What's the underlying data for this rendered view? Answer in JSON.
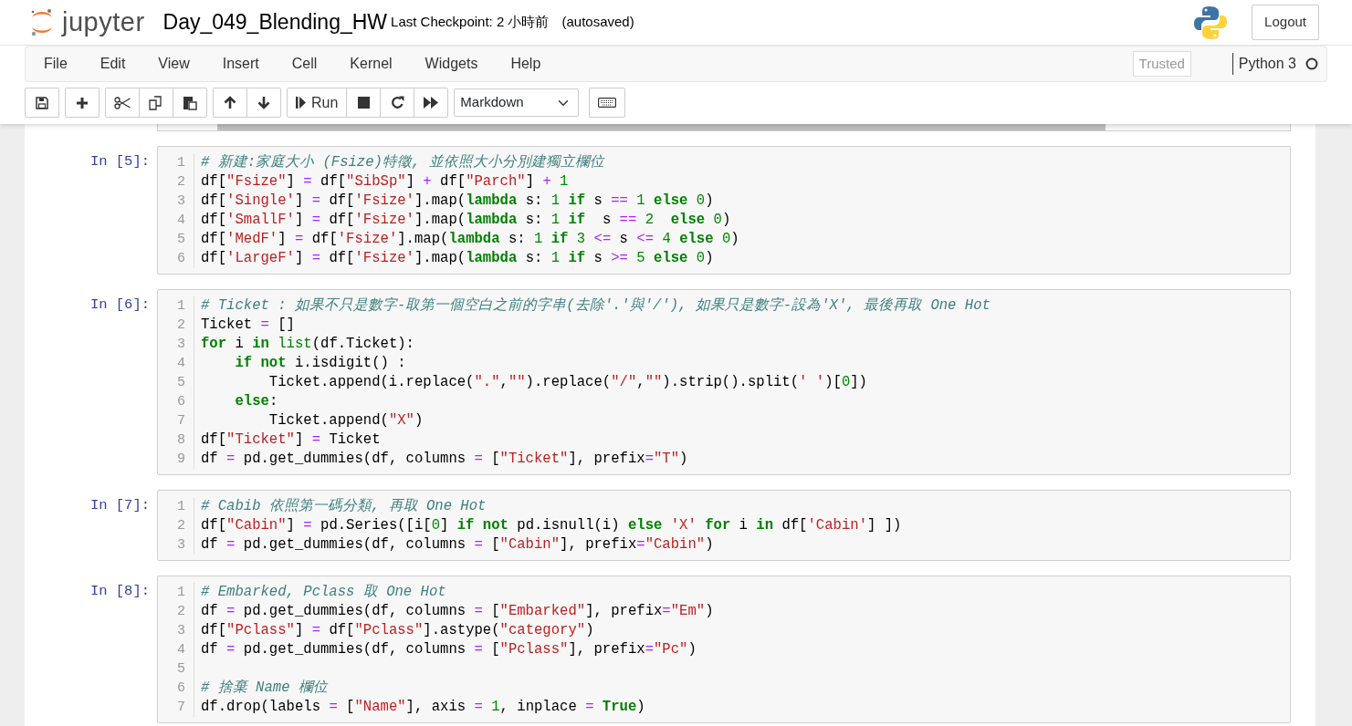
{
  "header": {
    "logo_text": "jupyter",
    "notebook_title": "Day_049_Blending_HW",
    "checkpoint": "Last Checkpoint: 2 小時前",
    "autosave": "(autosaved)",
    "logout": "Logout"
  },
  "menu": [
    "File",
    "Edit",
    "View",
    "Insert",
    "Cell",
    "Kernel",
    "Widgets",
    "Help"
  ],
  "trusted": "Trusted",
  "kernel": {
    "name": "Python 3",
    "busy": false
  },
  "toolbar": {
    "run_label": "Run",
    "cell_type": "Markdown"
  },
  "cells": [
    {
      "prompt": "In [5]:",
      "lines": [
        {
          "number": "1",
          "tokens": [
            {
              "kind": "comment",
              "text": "# 新建:家庭大小 (Fsize)特徵, 並依照大小分別建獨立欄位"
            }
          ]
        },
        {
          "number": "2",
          "tokens": [
            {
              "kind": "plain",
              "text": "df["
            },
            {
              "kind": "string",
              "text": "\"Fsize\""
            },
            {
              "kind": "plain",
              "text": "] "
            },
            {
              "kind": "operator",
              "text": "="
            },
            {
              "kind": "plain",
              "text": " df["
            },
            {
              "kind": "string",
              "text": "\"SibSp\""
            },
            {
              "kind": "plain",
              "text": "] "
            },
            {
              "kind": "operator",
              "text": "+"
            },
            {
              "kind": "plain",
              "text": " df["
            },
            {
              "kind": "string",
              "text": "\"Parch\""
            },
            {
              "kind": "plain",
              "text": "] "
            },
            {
              "kind": "operator",
              "text": "+ "
            },
            {
              "kind": "number",
              "text": "1"
            }
          ]
        },
        {
          "number": "3",
          "tokens": [
            {
              "kind": "plain",
              "text": "df["
            },
            {
              "kind": "string",
              "text": "'Single'"
            },
            {
              "kind": "plain",
              "text": "] "
            },
            {
              "kind": "operator",
              "text": "="
            },
            {
              "kind": "plain",
              "text": " df["
            },
            {
              "kind": "string",
              "text": "'Fsize'"
            },
            {
              "kind": "plain",
              "text": "].map("
            },
            {
              "kind": "keyword",
              "text": "lambda"
            },
            {
              "kind": "plain",
              "text": " s: "
            },
            {
              "kind": "number",
              "text": "1 "
            },
            {
              "kind": "keyword",
              "text": "if"
            },
            {
              "kind": "plain",
              "text": " s "
            },
            {
              "kind": "operator",
              "text": "== "
            },
            {
              "kind": "number",
              "text": "1 "
            },
            {
              "kind": "keyword",
              "text": "else "
            },
            {
              "kind": "number",
              "text": "0"
            },
            {
              "kind": "plain",
              "text": ")"
            }
          ]
        },
        {
          "number": "4",
          "tokens": [
            {
              "kind": "plain",
              "text": "df["
            },
            {
              "kind": "string",
              "text": "'SmallF'"
            },
            {
              "kind": "plain",
              "text": "] "
            },
            {
              "kind": "operator",
              "text": "="
            },
            {
              "kind": "plain",
              "text": " df["
            },
            {
              "kind": "string",
              "text": "'Fsize'"
            },
            {
              "kind": "plain",
              "text": "].map("
            },
            {
              "kind": "keyword",
              "text": "lambda"
            },
            {
              "kind": "plain",
              "text": " s: "
            },
            {
              "kind": "number",
              "text": "1 "
            },
            {
              "kind": "keyword",
              "text": "if"
            },
            {
              "kind": "plain",
              "text": "  s "
            },
            {
              "kind": "operator",
              "text": "== "
            },
            {
              "kind": "number",
              "text": "2  "
            },
            {
              "kind": "keyword",
              "text": "else "
            },
            {
              "kind": "number",
              "text": "0"
            },
            {
              "kind": "plain",
              "text": ")"
            }
          ]
        },
        {
          "number": "5",
          "tokens": [
            {
              "kind": "plain",
              "text": "df["
            },
            {
              "kind": "string",
              "text": "'MedF'"
            },
            {
              "kind": "plain",
              "text": "] "
            },
            {
              "kind": "operator",
              "text": "="
            },
            {
              "kind": "plain",
              "text": " df["
            },
            {
              "kind": "string",
              "text": "'Fsize'"
            },
            {
              "kind": "plain",
              "text": "].map("
            },
            {
              "kind": "keyword",
              "text": "lambda"
            },
            {
              "kind": "plain",
              "text": " s: "
            },
            {
              "kind": "number",
              "text": "1 "
            },
            {
              "kind": "keyword",
              "text": "if "
            },
            {
              "kind": "number",
              "text": "3 "
            },
            {
              "kind": "operator",
              "text": "<="
            },
            {
              "kind": "plain",
              "text": " s "
            },
            {
              "kind": "operator",
              "text": "<= "
            },
            {
              "kind": "number",
              "text": "4 "
            },
            {
              "kind": "keyword",
              "text": "else "
            },
            {
              "kind": "number",
              "text": "0"
            },
            {
              "kind": "plain",
              "text": ")"
            }
          ]
        },
        {
          "number": "6",
          "tokens": [
            {
              "kind": "plain",
              "text": "df["
            },
            {
              "kind": "string",
              "text": "'LargeF'"
            },
            {
              "kind": "plain",
              "text": "] "
            },
            {
              "kind": "operator",
              "text": "="
            },
            {
              "kind": "plain",
              "text": " df["
            },
            {
              "kind": "string",
              "text": "'Fsize'"
            },
            {
              "kind": "plain",
              "text": "].map("
            },
            {
              "kind": "keyword",
              "text": "lambda"
            },
            {
              "kind": "plain",
              "text": " s: "
            },
            {
              "kind": "number",
              "text": "1 "
            },
            {
              "kind": "keyword",
              "text": "if"
            },
            {
              "kind": "plain",
              "text": " s "
            },
            {
              "kind": "operator",
              "text": ">= "
            },
            {
              "kind": "number",
              "text": "5 "
            },
            {
              "kind": "keyword",
              "text": "else "
            },
            {
              "kind": "number",
              "text": "0"
            },
            {
              "kind": "plain",
              "text": ")"
            }
          ]
        }
      ]
    },
    {
      "prompt": "In [6]:",
      "lines": [
        {
          "number": "1",
          "tokens": [
            {
              "kind": "comment",
              "text": "# Ticket : 如果不只是數字-取第一個空白之前的字串(去除'.'與'/'), 如果只是數字-設為'X', 最後再取 One Hot"
            }
          ]
        },
        {
          "number": "2",
          "tokens": [
            {
              "kind": "plain",
              "text": "Ticket "
            },
            {
              "kind": "operator",
              "text": "="
            },
            {
              "kind": "plain",
              "text": " []"
            }
          ]
        },
        {
          "number": "3",
          "tokens": [
            {
              "kind": "keyword",
              "text": "for"
            },
            {
              "kind": "plain",
              "text": " i "
            },
            {
              "kind": "keyword",
              "text": "in "
            },
            {
              "kind": "builtin",
              "text": "list"
            },
            {
              "kind": "plain",
              "text": "(df.Ticket):"
            }
          ]
        },
        {
          "number": "4",
          "tokens": [
            {
              "kind": "keyword",
              "text": "    if not"
            },
            {
              "kind": "plain",
              "text": " i.isdigit() :"
            }
          ]
        },
        {
          "number": "5",
          "tokens": [
            {
              "kind": "plain",
              "text": "        Ticket.append(i.replace("
            },
            {
              "kind": "string",
              "text": "\".\""
            },
            {
              "kind": "plain",
              "text": ","
            },
            {
              "kind": "string",
              "text": "\"\""
            },
            {
              "kind": "plain",
              "text": ").replace("
            },
            {
              "kind": "string",
              "text": "\"/\""
            },
            {
              "kind": "plain",
              "text": ","
            },
            {
              "kind": "string",
              "text": "\"\""
            },
            {
              "kind": "plain",
              "text": ").strip().split("
            },
            {
              "kind": "string",
              "text": "' '"
            },
            {
              "kind": "plain",
              "text": ")["
            },
            {
              "kind": "number",
              "text": "0"
            },
            {
              "kind": "plain",
              "text": "])"
            }
          ]
        },
        {
          "number": "6",
          "tokens": [
            {
              "kind": "keyword",
              "text": "    else"
            },
            {
              "kind": "plain",
              "text": ":"
            }
          ]
        },
        {
          "number": "7",
          "tokens": [
            {
              "kind": "plain",
              "text": "        Ticket.append("
            },
            {
              "kind": "string",
              "text": "\"X\""
            },
            {
              "kind": "plain",
              "text": ")"
            }
          ]
        },
        {
          "number": "8",
          "tokens": [
            {
              "kind": "plain",
              "text": "df["
            },
            {
              "kind": "string",
              "text": "\"Ticket\""
            },
            {
              "kind": "plain",
              "text": "] "
            },
            {
              "kind": "operator",
              "text": "="
            },
            {
              "kind": "plain",
              "text": " Ticket"
            }
          ]
        },
        {
          "number": "9",
          "tokens": [
            {
              "kind": "plain",
              "text": "df "
            },
            {
              "kind": "operator",
              "text": "="
            },
            {
              "kind": "plain",
              "text": " pd.get_dummies(df, columns "
            },
            {
              "kind": "operator",
              "text": "="
            },
            {
              "kind": "plain",
              "text": " ["
            },
            {
              "kind": "string",
              "text": "\"Ticket\""
            },
            {
              "kind": "plain",
              "text": "], prefix"
            },
            {
              "kind": "operator",
              "text": "="
            },
            {
              "kind": "string",
              "text": "\"T\""
            },
            {
              "kind": "plain",
              "text": ")"
            }
          ]
        }
      ]
    },
    {
      "prompt": "In [7]:",
      "lines": [
        {
          "number": "1",
          "tokens": [
            {
              "kind": "comment",
              "text": "# Cabib 依照第一碼分類, 再取 One Hot"
            }
          ]
        },
        {
          "number": "2",
          "tokens": [
            {
              "kind": "plain",
              "text": "df["
            },
            {
              "kind": "string",
              "text": "\"Cabin\""
            },
            {
              "kind": "plain",
              "text": "] "
            },
            {
              "kind": "operator",
              "text": "="
            },
            {
              "kind": "plain",
              "text": " pd.Series([i["
            },
            {
              "kind": "number",
              "text": "0"
            },
            {
              "kind": "plain",
              "text": "] "
            },
            {
              "kind": "keyword",
              "text": "if not"
            },
            {
              "kind": "plain",
              "text": " pd.isnull(i) "
            },
            {
              "kind": "keyword",
              "text": "else "
            },
            {
              "kind": "string",
              "text": "'X' "
            },
            {
              "kind": "keyword",
              "text": "for"
            },
            {
              "kind": "plain",
              "text": " i "
            },
            {
              "kind": "keyword",
              "text": "in"
            },
            {
              "kind": "plain",
              "text": " df["
            },
            {
              "kind": "string",
              "text": "'Cabin'"
            },
            {
              "kind": "plain",
              "text": "] ])"
            }
          ]
        },
        {
          "number": "3",
          "tokens": [
            {
              "kind": "plain",
              "text": "df "
            },
            {
              "kind": "operator",
              "text": "="
            },
            {
              "kind": "plain",
              "text": " pd.get_dummies(df, columns "
            },
            {
              "kind": "operator",
              "text": "="
            },
            {
              "kind": "plain",
              "text": " ["
            },
            {
              "kind": "string",
              "text": "\"Cabin\""
            },
            {
              "kind": "plain",
              "text": "], prefix"
            },
            {
              "kind": "operator",
              "text": "="
            },
            {
              "kind": "string",
              "text": "\"Cabin\""
            },
            {
              "kind": "plain",
              "text": ")"
            }
          ]
        }
      ]
    },
    {
      "prompt": "In [8]:",
      "lines": [
        {
          "number": "1",
          "tokens": [
            {
              "kind": "comment",
              "text": "# Embarked, Pclass 取 One Hot"
            }
          ]
        },
        {
          "number": "2",
          "tokens": [
            {
              "kind": "plain",
              "text": "df "
            },
            {
              "kind": "operator",
              "text": "="
            },
            {
              "kind": "plain",
              "text": " pd.get_dummies(df, columns "
            },
            {
              "kind": "operator",
              "text": "="
            },
            {
              "kind": "plain",
              "text": " ["
            },
            {
              "kind": "string",
              "text": "\"Embarked\""
            },
            {
              "kind": "plain",
              "text": "], prefix"
            },
            {
              "kind": "operator",
              "text": "="
            },
            {
              "kind": "string",
              "text": "\"Em\""
            },
            {
              "kind": "plain",
              "text": ")"
            }
          ]
        },
        {
          "number": "3",
          "tokens": [
            {
              "kind": "plain",
              "text": "df["
            },
            {
              "kind": "string",
              "text": "\"Pclass\""
            },
            {
              "kind": "plain",
              "text": "] "
            },
            {
              "kind": "operator",
              "text": "="
            },
            {
              "kind": "plain",
              "text": " df["
            },
            {
              "kind": "string",
              "text": "\"Pclass\""
            },
            {
              "kind": "plain",
              "text": "].astype("
            },
            {
              "kind": "string",
              "text": "\"category\""
            },
            {
              "kind": "plain",
              "text": ")"
            }
          ]
        },
        {
          "number": "4",
          "tokens": [
            {
              "kind": "plain",
              "text": "df "
            },
            {
              "kind": "operator",
              "text": "="
            },
            {
              "kind": "plain",
              "text": " pd.get_dummies(df, columns "
            },
            {
              "kind": "operator",
              "text": "="
            },
            {
              "kind": "plain",
              "text": " ["
            },
            {
              "kind": "string",
              "text": "\"Pclass\""
            },
            {
              "kind": "plain",
              "text": "], prefix"
            },
            {
              "kind": "operator",
              "text": "="
            },
            {
              "kind": "string",
              "text": "\"Pc\""
            },
            {
              "kind": "plain",
              "text": ")"
            }
          ]
        },
        {
          "number": "5"
        },
        {
          "number": "6",
          "tokens": [
            {
              "kind": "comment",
              "text": "# 捨棄 Name 欄位"
            }
          ]
        },
        {
          "number": "7",
          "tokens": [
            {
              "kind": "plain",
              "text": "df.drop(labels "
            },
            {
              "kind": "operator",
              "text": "="
            },
            {
              "kind": "plain",
              "text": " ["
            },
            {
              "kind": "string",
              "text": "\"Name\""
            },
            {
              "kind": "plain",
              "text": "], axis "
            },
            {
              "kind": "operator",
              "text": "= "
            },
            {
              "kind": "number",
              "text": "1"
            },
            {
              "kind": "plain",
              "text": ", inplace "
            },
            {
              "kind": "operator",
              "text": "= "
            },
            {
              "kind": "keyword",
              "text": "True"
            },
            {
              "kind": "plain",
              "text": ")"
            }
          ]
        }
      ]
    }
  ]
}
